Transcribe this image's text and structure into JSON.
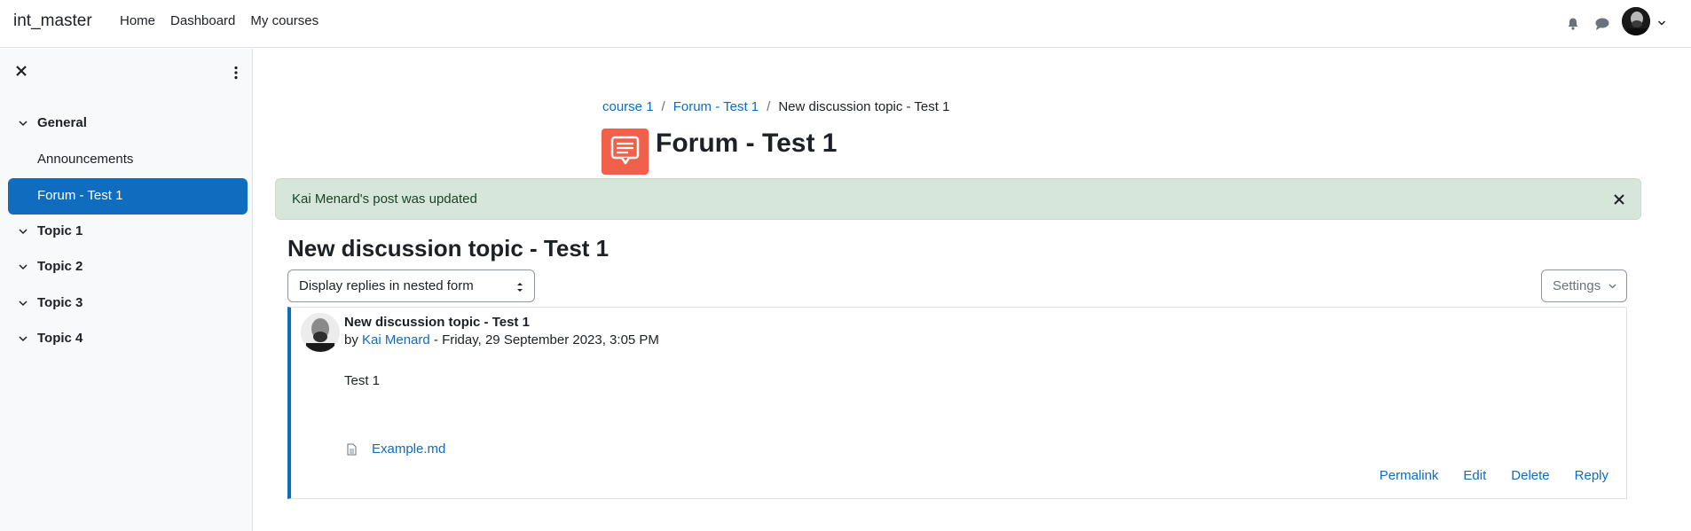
{
  "navbar": {
    "brand": "int_master",
    "links": [
      "Home",
      "Dashboard",
      "My courses"
    ],
    "icons": [
      "bell-icon",
      "chat-icon",
      "user-avatar",
      "chevron-down-icon"
    ]
  },
  "sidebar": {
    "sections": [
      {
        "label": "General",
        "items": [
          "Announcements",
          "Forum - Test 1"
        ]
      },
      {
        "label": "Topic 1"
      },
      {
        "label": "Topic 2"
      },
      {
        "label": "Topic 3"
      },
      {
        "label": "Topic 4"
      }
    ],
    "active_item": "Forum - Test 1"
  },
  "breadcrumb": {
    "items": [
      "course 1",
      "Forum - Test 1",
      "New discussion topic - Test 1"
    ],
    "separator": "/"
  },
  "page": {
    "title": "Forum - Test 1",
    "alert": "Kai Menard's post was updated",
    "discussion_title": "New discussion topic - Test 1",
    "display_mode": "Display replies in nested form",
    "settings_label": "Settings"
  },
  "post": {
    "subject": "New discussion topic - Test 1",
    "by": "by",
    "author": "Kai Menard",
    "date": " - Friday, 29 September 2023, 3:05 PM",
    "body": "Test 1",
    "attachment": "Example.md",
    "actions": [
      "Permalink",
      "Edit",
      "Delete",
      "Reply"
    ]
  },
  "colors": {
    "primary": "#0f6cbf",
    "alert_bg": "#d7e6da",
    "forum_icon": "#f0604b"
  }
}
